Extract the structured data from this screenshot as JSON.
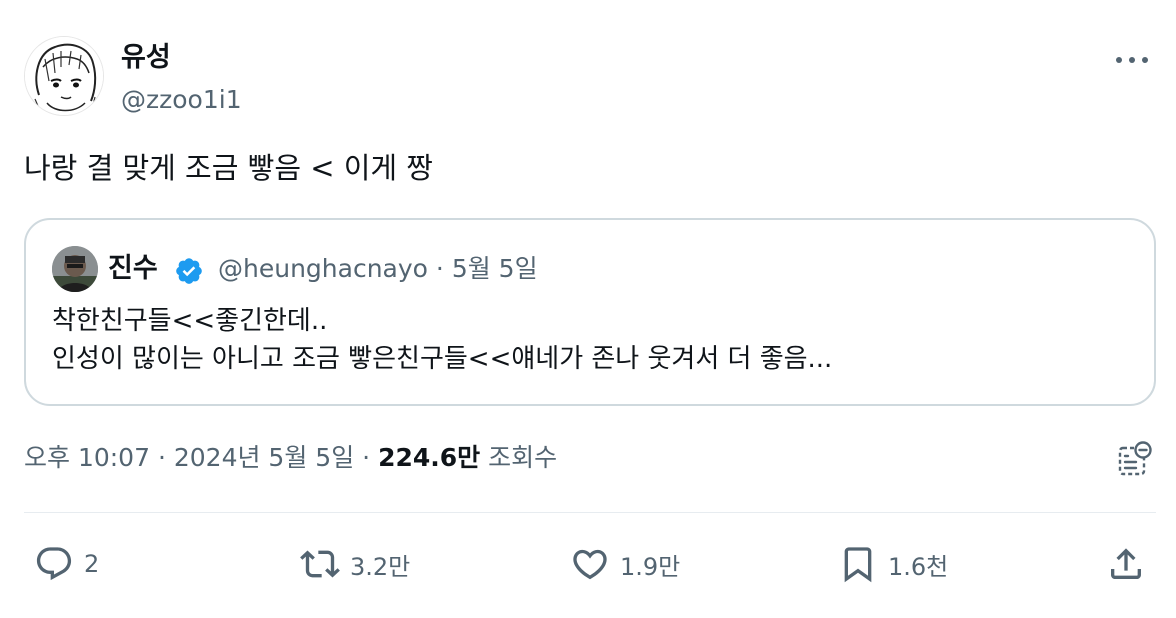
{
  "author": {
    "display_name": "유성",
    "handle": "@zzoo1i1"
  },
  "tweet": {
    "text": "나랑 결 맞게 조금 빻음 < 이게 짱"
  },
  "quoted_tweet": {
    "display_name": "진수",
    "handle": "@heunghacnayo",
    "separator": "·",
    "date": "5월 5일",
    "line1": "착한친구들<<좋긴한데..",
    "line2": "인성이 많이는 아니고 조금 빻은친구들<<얘네가 존나 웃겨서 더 좋음..."
  },
  "meta": {
    "time": "오후 10:07",
    "sep1": "·",
    "date": "2024년 5월 5일",
    "sep2": "·",
    "views_count": "224.6만",
    "views_label": "조회수"
  },
  "actions": {
    "replies": "2",
    "retweets": "3.2만",
    "likes": "1.9만",
    "bookmarks": "1.6천"
  },
  "colors": {
    "text": "#0f1419",
    "secondary": "#536471",
    "border": "#cfd9de",
    "verified": "#1d9bf0"
  },
  "icons": [
    "more-icon",
    "verified-badge-icon",
    "analytics-icon",
    "reply-icon",
    "retweet-icon",
    "like-icon",
    "bookmark-icon",
    "share-icon"
  ]
}
